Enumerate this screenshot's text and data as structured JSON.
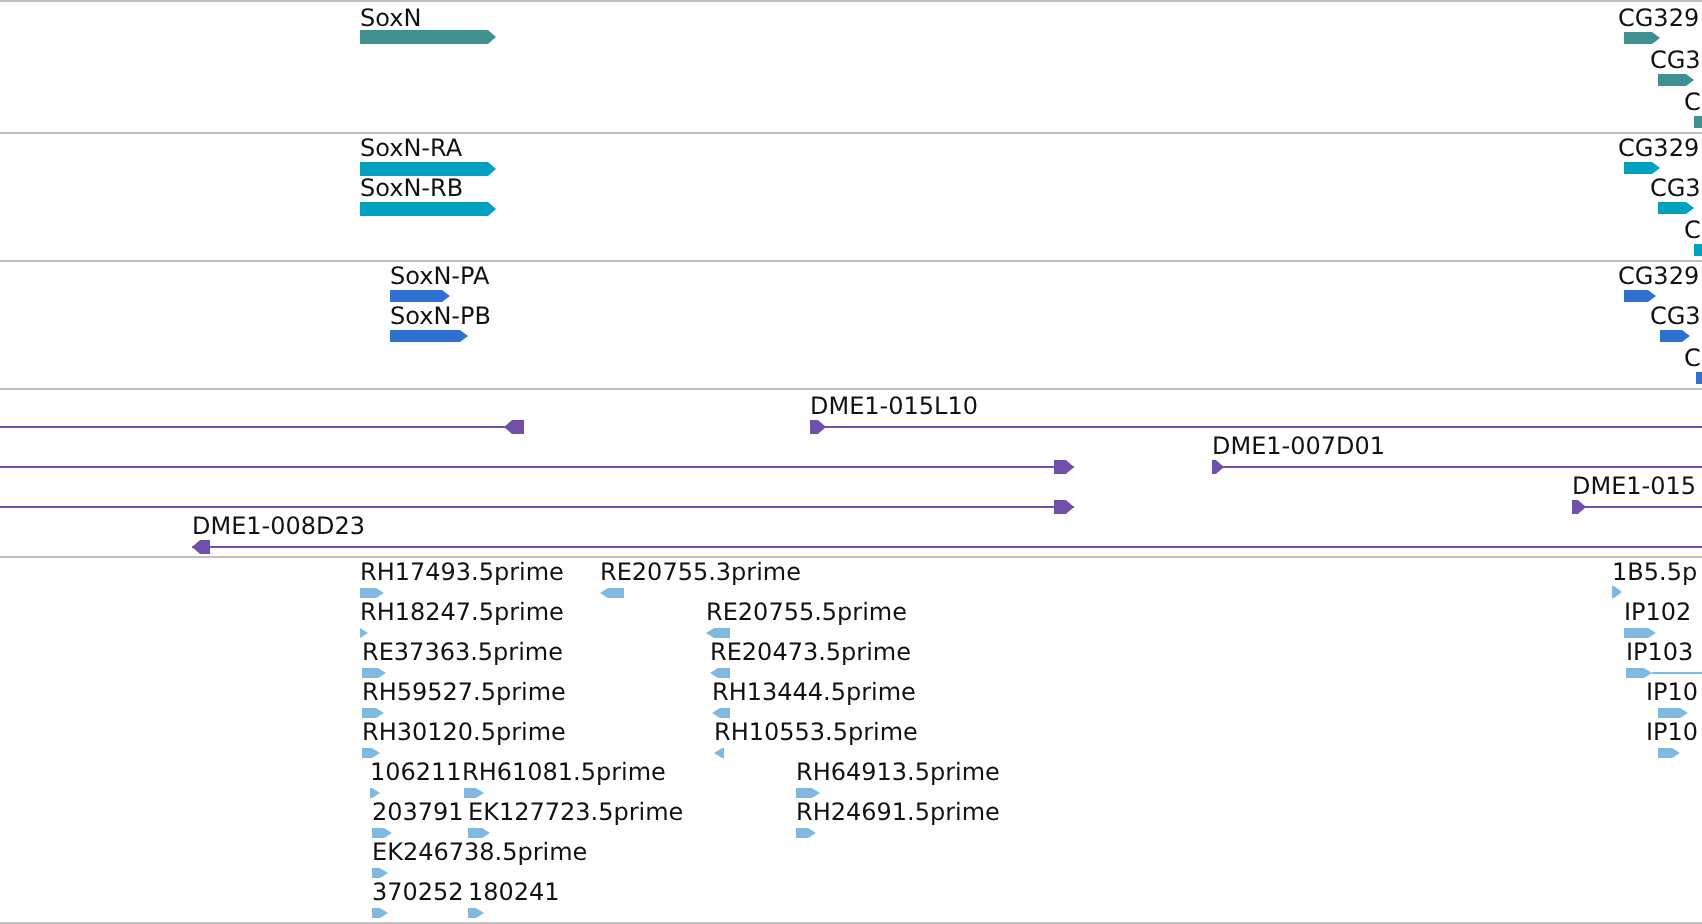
{
  "tracks": [
    {
      "kind": "gene",
      "color": "#409090",
      "features": [
        {
          "label": "SoxN",
          "reverse": false
        },
        {
          "label": "CG329",
          "reverse": false
        },
        {
          "label": "CG3",
          "reverse": false
        },
        {
          "label": "C",
          "reverse": false
        }
      ]
    },
    {
      "kind": "transcript",
      "color": "#00a0c0",
      "features": [
        {
          "label": "SoxN-RA",
          "reverse": false
        },
        {
          "label": "SoxN-RB",
          "reverse": false
        },
        {
          "label": "CG329",
          "reverse": false
        },
        {
          "label": "CG3",
          "reverse": false
        },
        {
          "label": "C",
          "reverse": false
        }
      ]
    },
    {
      "kind": "protein",
      "color": "#3070d0",
      "features": [
        {
          "label": "SoxN-PA",
          "reverse": false
        },
        {
          "label": "SoxN-PB",
          "reverse": false
        },
        {
          "label": "CG329",
          "reverse": false
        },
        {
          "label": "CG3",
          "reverse": false
        },
        {
          "label": "C",
          "reverse": false
        }
      ]
    },
    {
      "kind": "clone",
      "color": "#7050a8",
      "features": [
        {
          "reverse": true
        },
        {
          "label": "DME1-015L10",
          "reverse": false
        },
        {
          "reverse": false
        },
        {
          "label": "DME1-007D01",
          "reverse": false
        },
        {
          "reverse": false
        },
        {
          "label": "DME1-015",
          "reverse": false
        },
        {
          "label": "DME1-008D23",
          "reverse": true
        }
      ]
    },
    {
      "kind": "est",
      "color": "#80b8e0",
      "features": [
        {
          "label": "RH17493.5prime",
          "reverse": false
        },
        {
          "label": "RE20755.3prime",
          "reverse": true
        },
        {
          "label": "1B5.5p",
          "reverse": false
        },
        {
          "label": "RH18247.5prime",
          "reverse": false
        },
        {
          "label": "RE20755.5prime",
          "reverse": true
        },
        {
          "label": "IP102",
          "reverse": false
        },
        {
          "label": "RE37363.5prime",
          "reverse": false
        },
        {
          "label": "RE20473.5prime",
          "reverse": true
        },
        {
          "label": "IP103",
          "reverse": false
        },
        {
          "label": "RH59527.5prime",
          "reverse": false
        },
        {
          "label": "RH13444.5prime",
          "reverse": true
        },
        {
          "label": "IP10",
          "reverse": false
        },
        {
          "label": "RH30120.5prime",
          "reverse": false
        },
        {
          "label": "RH10553.5prime",
          "reverse": true
        },
        {
          "label": "IP10",
          "reverse": false
        },
        {
          "label": "106211",
          "reverse": false
        },
        {
          "label": "RH61081.5prime",
          "reverse": false
        },
        {
          "label": "RH64913.5prime",
          "reverse": false
        },
        {
          "label": "203791",
          "reverse": false
        },
        {
          "label": "EK127723.5prime",
          "reverse": false
        },
        {
          "label": "RH24691.5prime",
          "reverse": false
        },
        {
          "label": "EK246738.5prime",
          "reverse": false
        },
        {
          "label": "370252",
          "reverse": false
        },
        {
          "label": "180241",
          "reverse": false
        }
      ]
    }
  ]
}
